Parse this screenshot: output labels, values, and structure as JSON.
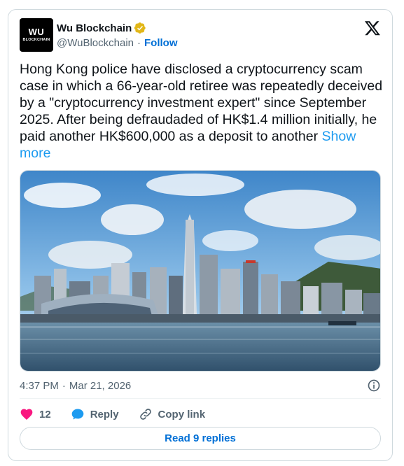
{
  "author": {
    "avatar_line1": "WU",
    "avatar_line2": "BLOCKCHAIN",
    "name": "Wu Blockchain",
    "handle": "@WuBlockchain",
    "separator": "·",
    "follow_label": "Follow",
    "verified_icon": "verified-badge-icon",
    "verified_color": "#e2b719"
  },
  "platform_icon": "x-logo-icon",
  "tweet": {
    "text": "Hong Kong police have disclosed a cryptocurrency scam case in which a 66-year-old retiree was repeatedly deceived by a \"cryptocurrency investment expert\" since September 2025. After being defraudaded of HK$1.4 million initially, he paid another HK$600,000 as a deposit to another",
    "show_more_label": "Show more",
    "image_alt": "Hong Kong Victoria Harbour skyline",
    "time": "4:37 PM",
    "date_separator": "·",
    "date": "Mar 21, 2026"
  },
  "actions": {
    "like_count": "12",
    "reply_label": "Reply",
    "copy_label": "Copy link",
    "read_replies_label": "Read 9 replies"
  },
  "colors": {
    "accent": "#1d9bf0",
    "link": "#006fd6",
    "heart": "#f91880",
    "muted": "#536471",
    "border": "#cfd9de"
  }
}
